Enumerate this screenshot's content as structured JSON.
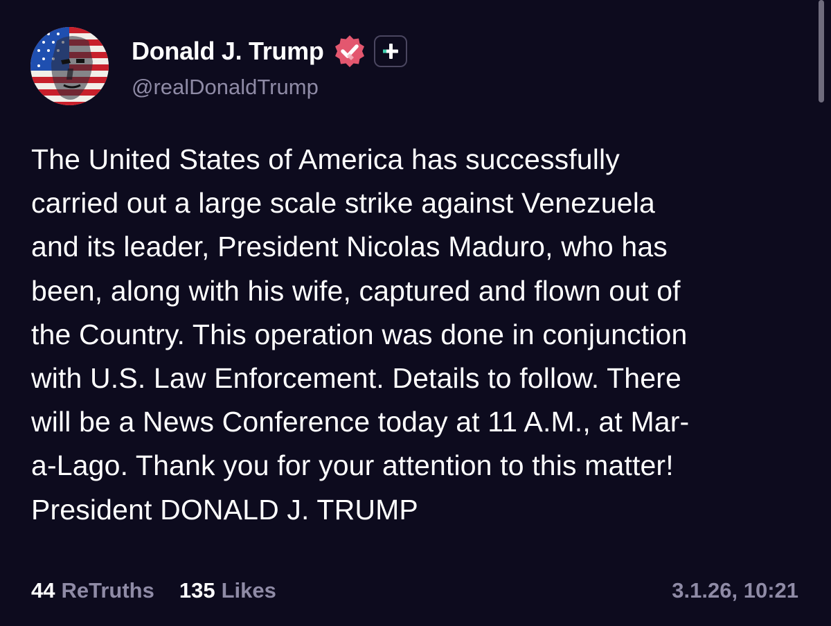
{
  "author": {
    "display_name": "Donald J. Trump",
    "handle": "@realDonaldTrump",
    "verified_icon": "verified-badge-icon",
    "add_icon": "plus-icon"
  },
  "post": {
    "text": "The United States of America has successfully\ncarried out a large scale strike against Venezuela\nand its leader, President Nicolas Maduro, who has\nbeen, along with his wife, captured and flown out of\nthe Country. This operation was done in conjunction\nwith U.S. Law Enforcement. Details to follow. There\nwill be a News Conference today at 11 A.M., at Mar-\na-Lago. Thank you for your attention to this matter!\nPresident DONALD J. TRUMP"
  },
  "stats": {
    "retruths_count": "44",
    "retruths_label": "ReTruths",
    "likes_count": "135",
    "likes_label": "Likes"
  },
  "timestamp": "3.1.26, 10:21",
  "colors": {
    "background": "#0d0b1e",
    "primary_text": "#ffffff",
    "secondary_text": "#8f8ba6",
    "verified_badge": "#e3576f",
    "add_button_accent": "#41d1b0"
  }
}
